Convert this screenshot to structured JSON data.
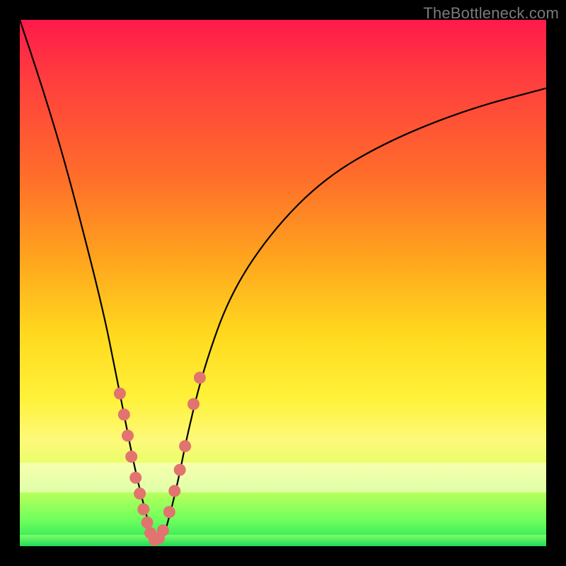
{
  "watermark": "TheBottleneck.com",
  "colors": {
    "gradient_top": "#ff1a4b",
    "gradient_mid": "#ffda1e",
    "gradient_bottom": "#22e05a",
    "dot_fill": "#e2736f",
    "frame": "#000000"
  },
  "chart_data": {
    "type": "line",
    "title": "",
    "xlabel": "",
    "ylabel": "",
    "xlim": [
      0,
      100
    ],
    "ylim": [
      0,
      100
    ],
    "annotations": [
      "TheBottleneck.com"
    ],
    "series": [
      {
        "name": "bottleneck-curve",
        "x": [
          0,
          4,
          8,
          12,
          16,
          18,
          20,
          22,
          24,
          25.5,
          27,
          28,
          30,
          32,
          35,
          40,
          48,
          58,
          70,
          85,
          100
        ],
        "values": [
          100,
          88,
          75,
          60,
          44,
          34,
          24,
          14,
          6,
          1,
          1,
          4,
          12,
          22,
          34,
          48,
          60,
          70,
          77,
          83,
          87
        ]
      }
    ],
    "dots": {
      "name": "highlight-dots",
      "x": [
        19.0,
        19.8,
        20.5,
        21.2,
        22.0,
        22.8,
        23.5,
        24.2,
        24.8,
        25.6,
        26.4,
        27.2,
        28.4,
        29.4,
        30.4,
        31.4,
        33.0,
        34.2
      ],
      "values": [
        29.0,
        25.0,
        21.0,
        17.0,
        13.0,
        10.0,
        7.0,
        4.5,
        2.5,
        1.2,
        1.5,
        3.0,
        6.5,
        10.5,
        14.5,
        19.0,
        27.0,
        32.0
      ]
    }
  }
}
